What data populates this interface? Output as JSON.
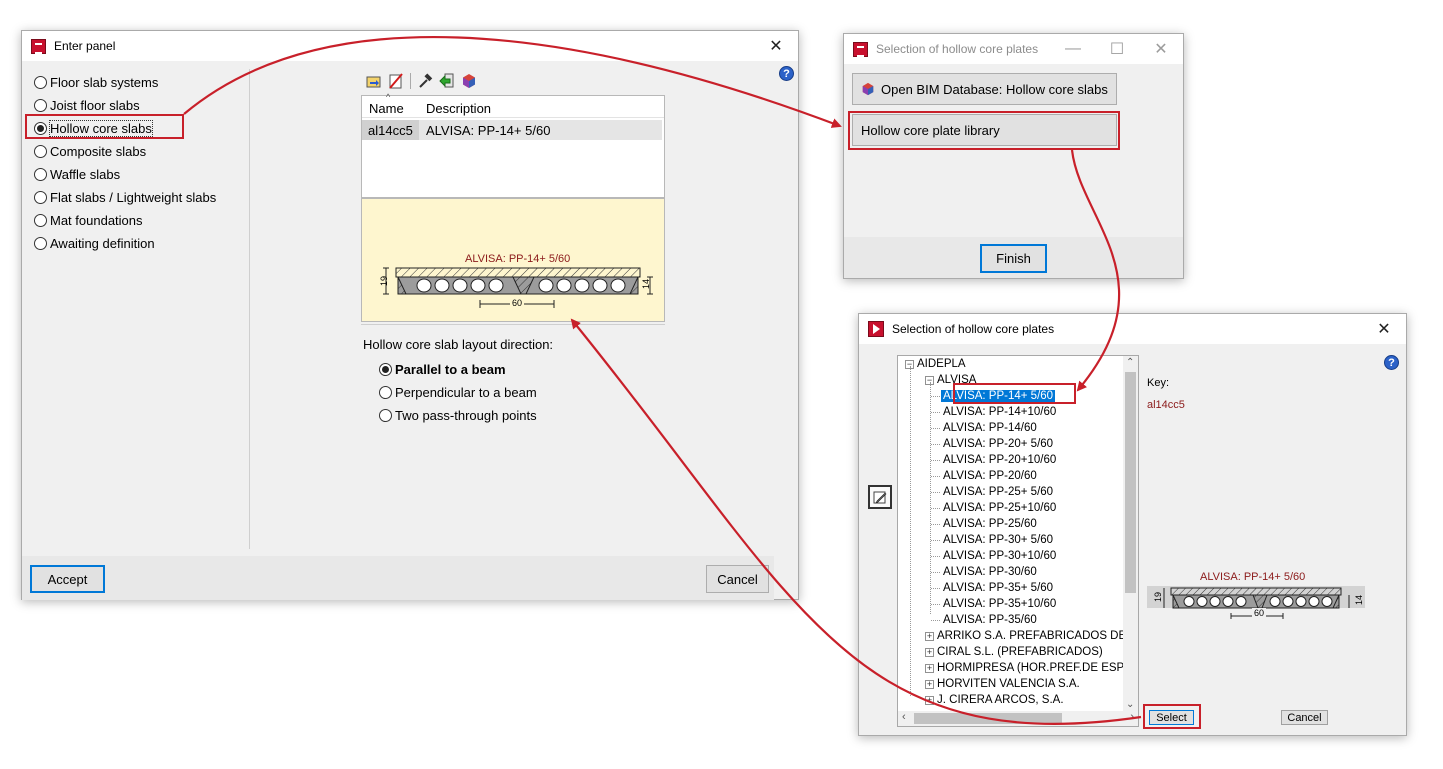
{
  "enter_panel": {
    "title": "Enter panel",
    "floor_types": [
      {
        "label": "Floor slab systems",
        "selected": false
      },
      {
        "label": "Joist floor slabs",
        "selected": false
      },
      {
        "label": "Hollow core slabs",
        "selected": true
      },
      {
        "label": "Composite slabs",
        "selected": false
      },
      {
        "label": "Waffle slabs",
        "selected": false
      },
      {
        "label": "Flat slabs / Lightweight slabs",
        "selected": false
      },
      {
        "label": "Mat foundations",
        "selected": false
      },
      {
        "label": "Awaiting definition",
        "selected": false
      }
    ],
    "table": {
      "columns": [
        "Name",
        "Description"
      ],
      "rows": [
        {
          "name": "al14cc5",
          "description": "ALVISA: PP-14+ 5/60"
        }
      ]
    },
    "preview": {
      "label": "ALVISA: PP-14+ 5/60",
      "dim_height_total": "19",
      "dim_height_slab": "14",
      "dim_width": "60"
    },
    "layout": {
      "heading": "Hollow core slab layout direction:",
      "options": [
        {
          "label": "Parallel to a beam",
          "selected": true
        },
        {
          "label": "Perpendicular to a beam",
          "selected": false
        },
        {
          "label": "Two pass-through points",
          "selected": false
        }
      ]
    },
    "accept_label": "Accept",
    "cancel_label": "Cancel",
    "help_glyph": "?"
  },
  "selection_small": {
    "title": "Selection of hollow core plates",
    "bim_button_label": "Open BIM Database: Hollow core slabs",
    "library_button_label": "Hollow core plate library",
    "finish_label": "Finish"
  },
  "selection_tree": {
    "title": "Selection of hollow core plates",
    "root": "AIDEPLA",
    "group": "ALVISA",
    "items": [
      "ALVISA: PP-14+ 5/60",
      "ALVISA: PP-14+10/60",
      "ALVISA: PP-14/60",
      "ALVISA: PP-20+ 5/60",
      "ALVISA: PP-20+10/60",
      "ALVISA: PP-20/60",
      "ALVISA: PP-25+ 5/60",
      "ALVISA: PP-25+10/60",
      "ALVISA: PP-25/60",
      "ALVISA: PP-30+ 5/60",
      "ALVISA: PP-30+10/60",
      "ALVISA: PP-30/60",
      "ALVISA: PP-35+ 5/60",
      "ALVISA: PP-35+10/60",
      "ALVISA: PP-35/60"
    ],
    "selected_index": 0,
    "other_groups": [
      "ARRIKO S.A. PREFABRICADOS DE H",
      "CIRAL S.L. (PREFABRICADOS)",
      "HORMIPRESA (HOR.PREF.DE ESPA",
      "HORVITEN VALENCIA S.A.",
      "J. CIRERA ARCOS, S.A."
    ],
    "key_label": "Key:",
    "key_value": "al14cc5",
    "preview_label": "ALVISA: PP-14+ 5/60",
    "dim_height_total": "19",
    "dim_height_slab": "14",
    "dim_width": "60",
    "select_label": "Select",
    "cancel_label": "Cancel",
    "help_glyph": "?"
  },
  "colors": {
    "annotation_red": "#c8202a",
    "selection_blue": "#0078d7",
    "preview_bg": "#fef6cf",
    "key_red": "#8b1a1a"
  }
}
